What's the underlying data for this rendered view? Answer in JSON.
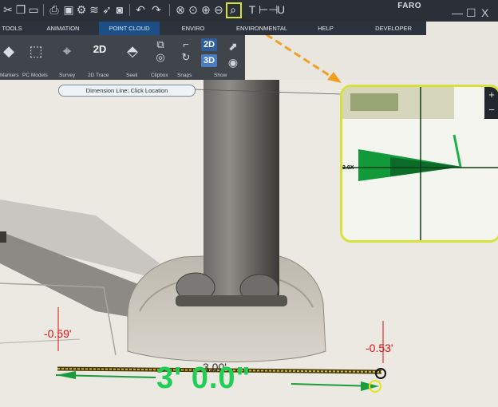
{
  "toolbar": {
    "icons": [
      "scissors-icon",
      "copy-icon",
      "paste-icon",
      "print-icon",
      "save-icon",
      "settings-icon",
      "layers-icon",
      "send-icon",
      "camera-icon",
      "undo-icon",
      "redo-icon",
      "zoom-extents-icon",
      "zoom-window-icon",
      "zoom-in-icon",
      "zoom-out-icon",
      "magnifier-icon",
      "text-icon",
      "dimension-icon",
      "underline-icon"
    ],
    "text_label": "T",
    "dimension_label": "⊢⊣",
    "underline_label": "U"
  },
  "brand": "FARO",
  "window_buttons": {
    "minimize": "—",
    "restore": "☐",
    "close": "X"
  },
  "menu": {
    "tabs": [
      {
        "label": "TOOLS"
      },
      {
        "label": "ANIMATION"
      },
      {
        "label": "POINT CLOUD",
        "active": true
      },
      {
        "label": "ENVIRO"
      },
      {
        "label": "ENVIRONMENTAL"
      },
      {
        "label": "HELP"
      },
      {
        "label": "DEVELOPER"
      }
    ]
  },
  "ribbon": {
    "groups": [
      {
        "label": "Markers"
      },
      {
        "label": "PC Models"
      },
      {
        "label": "Survey"
      },
      {
        "label": "2D Trace"
      },
      {
        "label": "Seeli"
      },
      {
        "label": "Clipbox"
      },
      {
        "label": "Snaps"
      },
      {
        "label": "Show"
      }
    ],
    "trace_badge": "2D",
    "view_2d": "2D",
    "view_3d": "3D"
  },
  "status": {
    "text": "Dimension Line: Click Location"
  },
  "magnifier": {
    "label": "3.0X",
    "zoom_in": "+",
    "zoom_out": "−"
  },
  "measurement": {
    "left_height": "-0.59'",
    "right_height": "-0.53'",
    "length": "3.00'",
    "length_big": "3' 0.0\""
  },
  "colors": {
    "accent": "#d6e23a",
    "dimension_green": "#1fce53",
    "height_red": "#e01010",
    "arrow_orange": "#f0a020"
  }
}
